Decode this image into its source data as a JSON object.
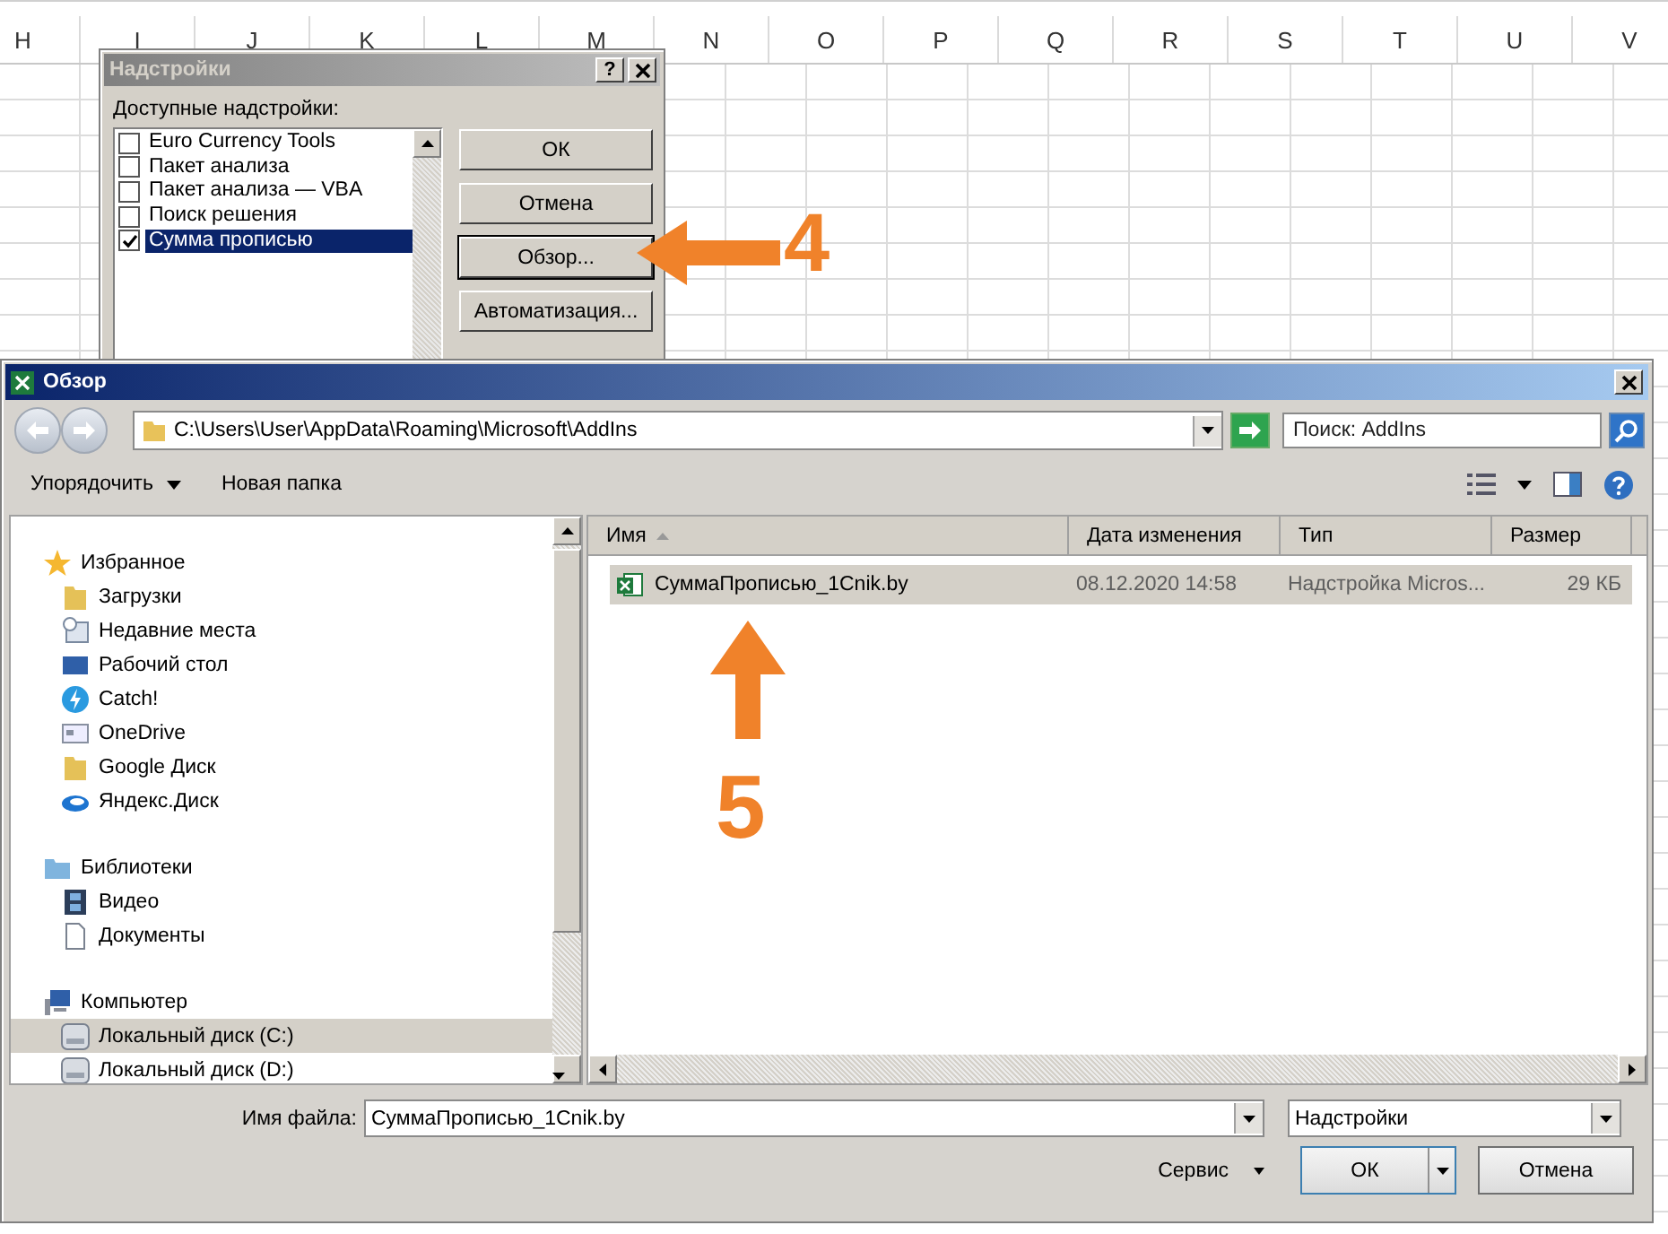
{
  "spreadsheet": {
    "columns": [
      "H",
      "I",
      "J",
      "K",
      "L",
      "M",
      "N",
      "O",
      "P",
      "Q",
      "R",
      "S",
      "T",
      "U",
      "V"
    ]
  },
  "addins_dialog": {
    "title": "Надстройки",
    "help_button": "?",
    "list_label": "Доступные надстройки:",
    "addins": [
      {
        "label": "Euro Currency Tools",
        "checked": false,
        "selected": false
      },
      {
        "label": "Пакет анализа",
        "checked": false,
        "selected": false
      },
      {
        "label": "Пакет анализа — VBA",
        "checked": false,
        "selected": false
      },
      {
        "label": "Поиск решения",
        "checked": false,
        "selected": false
      },
      {
        "label": "Сумма прописью",
        "checked": true,
        "selected": true
      }
    ],
    "buttons": [
      {
        "label": "ОК",
        "focused": false
      },
      {
        "label": "Отмена",
        "focused": false
      },
      {
        "label": "Обзор...",
        "focused": true
      },
      {
        "label": "Автоматизация...",
        "focused": false
      }
    ]
  },
  "annotations": [
    {
      "label": "4"
    },
    {
      "label": "5"
    }
  ],
  "browse_dialog": {
    "title": "Обзор",
    "address": "C:\\Users\\User\\AppData\\Roaming\\Microsoft\\AddIns",
    "search": {
      "placeholder": "Поиск: AddIns"
    },
    "toolbar": [
      "Упорядочить",
      "Новая папка"
    ],
    "nav": [
      {
        "label": "Избранное",
        "selected": false,
        "children": [
          {
            "label": "Загрузки",
            "selected": false
          },
          {
            "label": "Недавние места",
            "selected": false
          },
          {
            "label": "Рабочий стол",
            "selected": false
          },
          {
            "label": "Catch!",
            "selected": false
          },
          {
            "label": "OneDrive",
            "selected": false
          },
          {
            "label": "Google Диск",
            "selected": false
          },
          {
            "label": "Яндекс.Диск",
            "selected": false
          }
        ]
      },
      {
        "label": "Библиотеки",
        "selected": false,
        "children": [
          {
            "label": "Видео",
            "selected": false
          },
          {
            "label": "Документы",
            "selected": false
          }
        ]
      },
      {
        "label": "Компьютер",
        "selected": false,
        "children": [
          {
            "label": "Локальный диск (C:)",
            "selected": true
          },
          {
            "label": "Локальный диск (D:)",
            "selected": false
          }
        ]
      }
    ],
    "columns": [
      {
        "label": "Имя",
        "sorted": true
      },
      {
        "label": "Дата изменения",
        "sorted": false
      },
      {
        "label": "Тип",
        "sorted": false
      },
      {
        "label": "Размер",
        "sorted": false
      }
    ],
    "files": [
      {
        "name": "СуммаПрописью_1Cnik.by",
        "date": "08.12.2020 14:58",
        "type": "Надстройка Micros...",
        "size": "29 КБ",
        "selected": true
      }
    ],
    "filename": {
      "label": "Имя файла:",
      "value": "СуммаПрописью_1Cnik.by"
    },
    "filter": "Надстройки",
    "tools": "Сервис",
    "buttons": [
      {
        "label": "ОК",
        "default": true
      },
      {
        "label": "Отмена",
        "default": false
      }
    ]
  }
}
